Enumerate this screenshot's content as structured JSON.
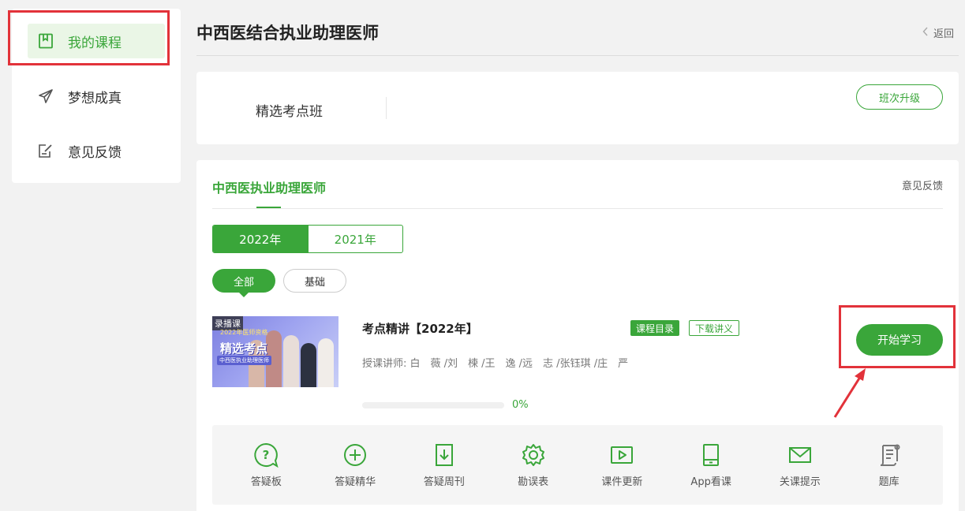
{
  "sidebar": {
    "items": [
      {
        "label": "我的课程",
        "icon": "bookmark-icon"
      },
      {
        "label": "梦想成真",
        "icon": "paper-plane-icon"
      },
      {
        "label": "意见反馈",
        "icon": "edit-note-icon"
      }
    ]
  },
  "header": {
    "title": "中西医结合执业助理医师",
    "back_label": "返回"
  },
  "class_card": {
    "class_name": "精选考点班",
    "upgrade_label": "班次升级"
  },
  "main": {
    "tab_title": "中西医执业助理医师",
    "feedback_label": "意见反馈",
    "years": [
      "2022年",
      "2021年"
    ],
    "filters": [
      "全部",
      "基础"
    ],
    "course": {
      "badge": "录播课",
      "thumb_line1": "2022年医师资格",
      "thumb_title": "精选考点",
      "thumb_sub": "中西医执业助理医师",
      "title": "考点精讲【2022年】",
      "tag_catalog": "课程目录",
      "tag_download": "下载讲义",
      "teachers": "授课讲师:  白　薇 /刘　楝 /王　逸 /远　志 /张钰琪 /庄　严",
      "progress_pct": "0%",
      "progress_value": 0,
      "start_label": "开始学习"
    },
    "tools": [
      {
        "label": "答疑板",
        "icon": "question-bubble-icon"
      },
      {
        "label": "答疑精华",
        "icon": "plus-circle-icon"
      },
      {
        "label": "答疑周刊",
        "icon": "download-doc-icon"
      },
      {
        "label": "勘误表",
        "icon": "gear-icon"
      },
      {
        "label": "课件更新",
        "icon": "video-play-icon"
      },
      {
        "label": "App看课",
        "icon": "tablet-icon"
      },
      {
        "label": "关课提示",
        "icon": "mail-icon"
      },
      {
        "label": "题库",
        "icon": "scroll-icon"
      }
    ]
  },
  "colors": {
    "accent": "#3aa63a",
    "annotation": "#e2323a"
  }
}
